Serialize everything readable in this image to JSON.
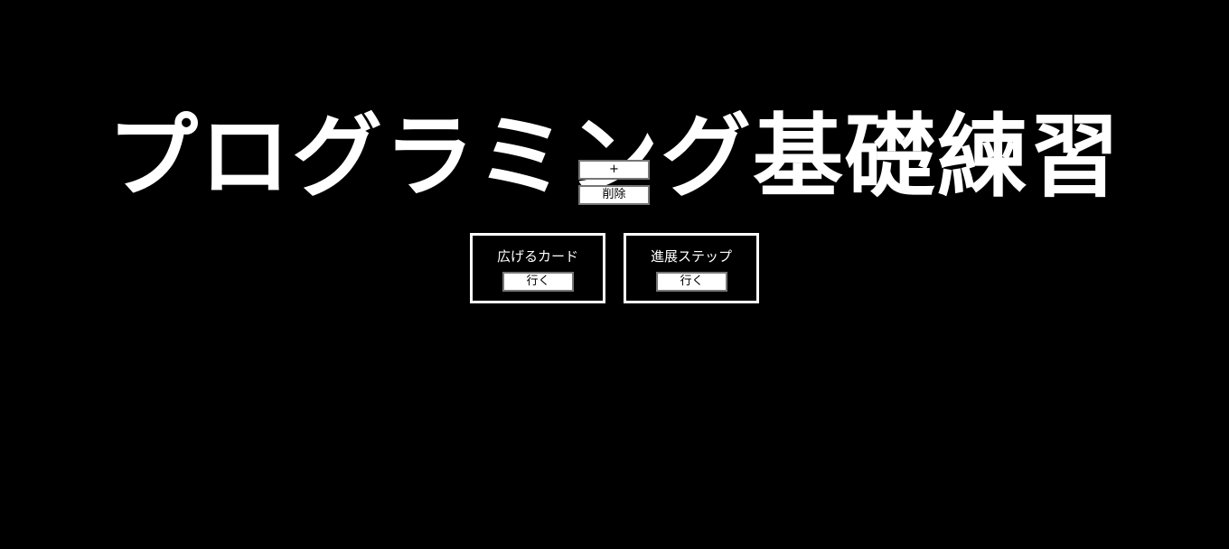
{
  "page": {
    "title": "プログラミング基礎練習"
  },
  "controls": {
    "add_label": "+",
    "delete_label": "削除"
  },
  "cards": [
    {
      "title": "広げるカード",
      "button_label": "行く"
    },
    {
      "title": "進展ステップ",
      "button_label": "行く"
    }
  ],
  "colors": {
    "background": "#000000",
    "foreground": "#ffffff",
    "button_bg": "#ffffff",
    "button_text": "#000000"
  }
}
